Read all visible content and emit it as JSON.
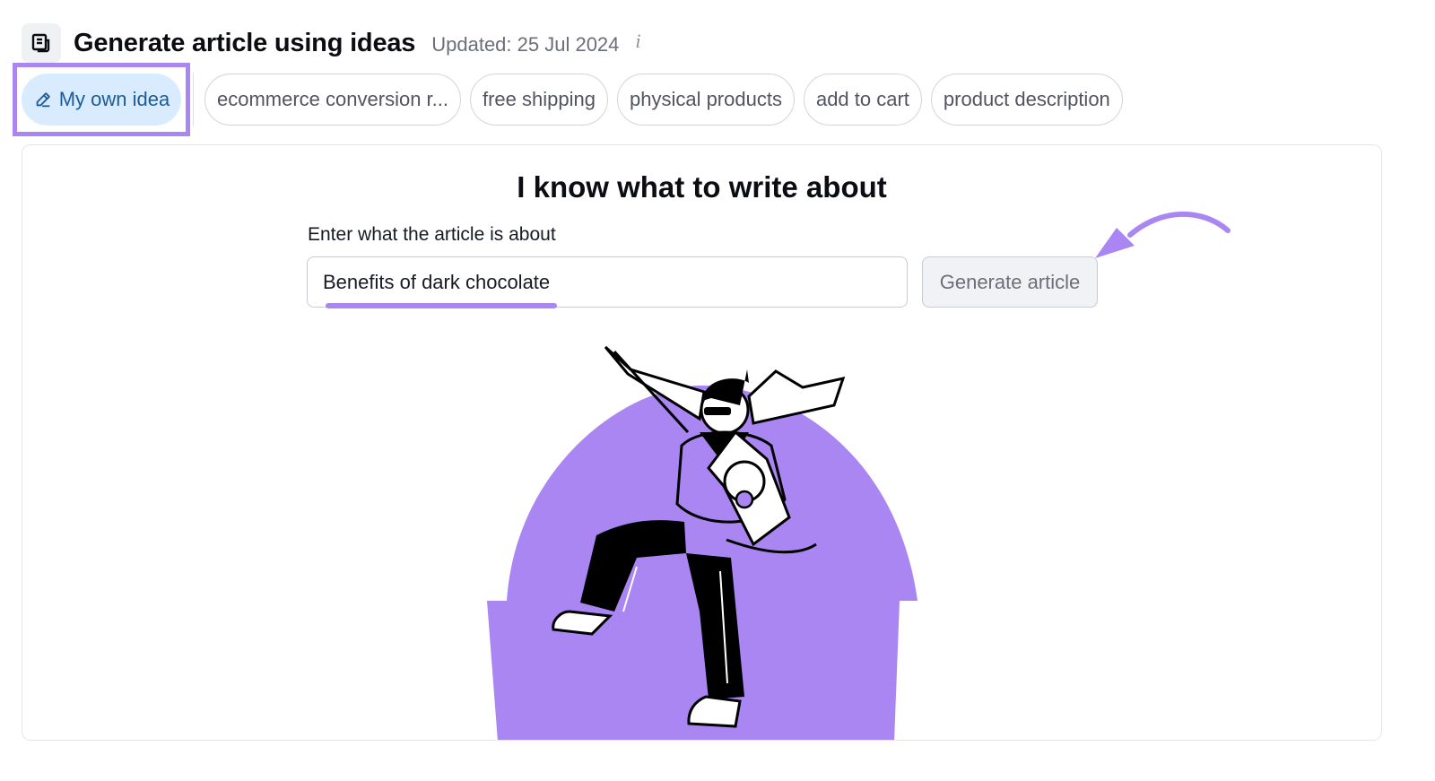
{
  "header": {
    "title": "Generate article using ideas",
    "updated": "Updated: 25 Jul 2024",
    "info_glyph": "i",
    "icon": "document-icon"
  },
  "chips": {
    "own_idea": {
      "label": "My own idea",
      "icon": "pencil-icon",
      "selected": true
    },
    "ideas": [
      "ecommerce conversion r...",
      "free shipping",
      "physical products",
      "add to cart",
      "product description"
    ]
  },
  "main": {
    "title": "I know what to write about",
    "field_label": "Enter what the article is about",
    "input_value": "Benefits of dark chocolate",
    "generate_label": "Generate article"
  },
  "colors": {
    "accent_purple": "#a986f2",
    "selected_chip_bg": "#d9ecff",
    "selected_chip_text": "#1b5c97"
  }
}
